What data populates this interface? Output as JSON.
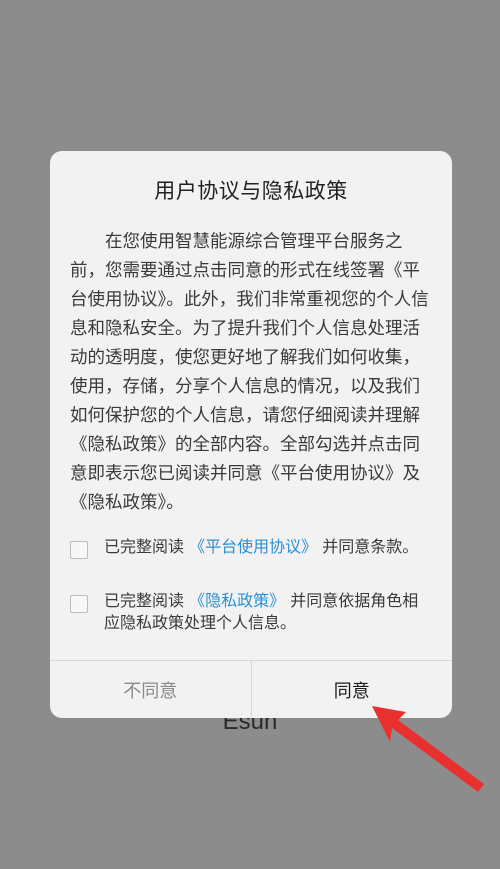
{
  "background": {
    "app_name": "Esun",
    "color": "#8c8c8c"
  },
  "dialog": {
    "title": "用户协议与隐私政策",
    "body": "在您使用智慧能源综合管理平台服务之前，您需要通过点击同意的形式在线签署《平台使用协议》。此外，我们非常重视您的个人信息和隐私安全。为了提升我们个人信息处理活动的透明度，使您更好地了解我们如何收集，使用，存储，分享个人信息的情况，以及我们如何保护您的个人信息，请您仔细阅读并理解《隐私政策》的全部内容。全部勾选并点击同意即表示您已阅读并同意《平台使用协议》及《隐私政策》。",
    "checkbox_1": {
      "prefix": "已完整阅读 ",
      "link": "《平台使用协议》",
      "suffix": " 并同意条款。",
      "checked": false
    },
    "checkbox_2": {
      "prefix": "已完整阅读 ",
      "link": "《隐私政策》",
      "suffix": " 并同意依据角色相应隐私政策处理个人信息。",
      "checked": false
    },
    "buttons": {
      "disagree": "不同意",
      "agree": "同意"
    },
    "link_color": "#2a8fd6"
  },
  "annotation": {
    "arrow_color": "#e8312f"
  }
}
